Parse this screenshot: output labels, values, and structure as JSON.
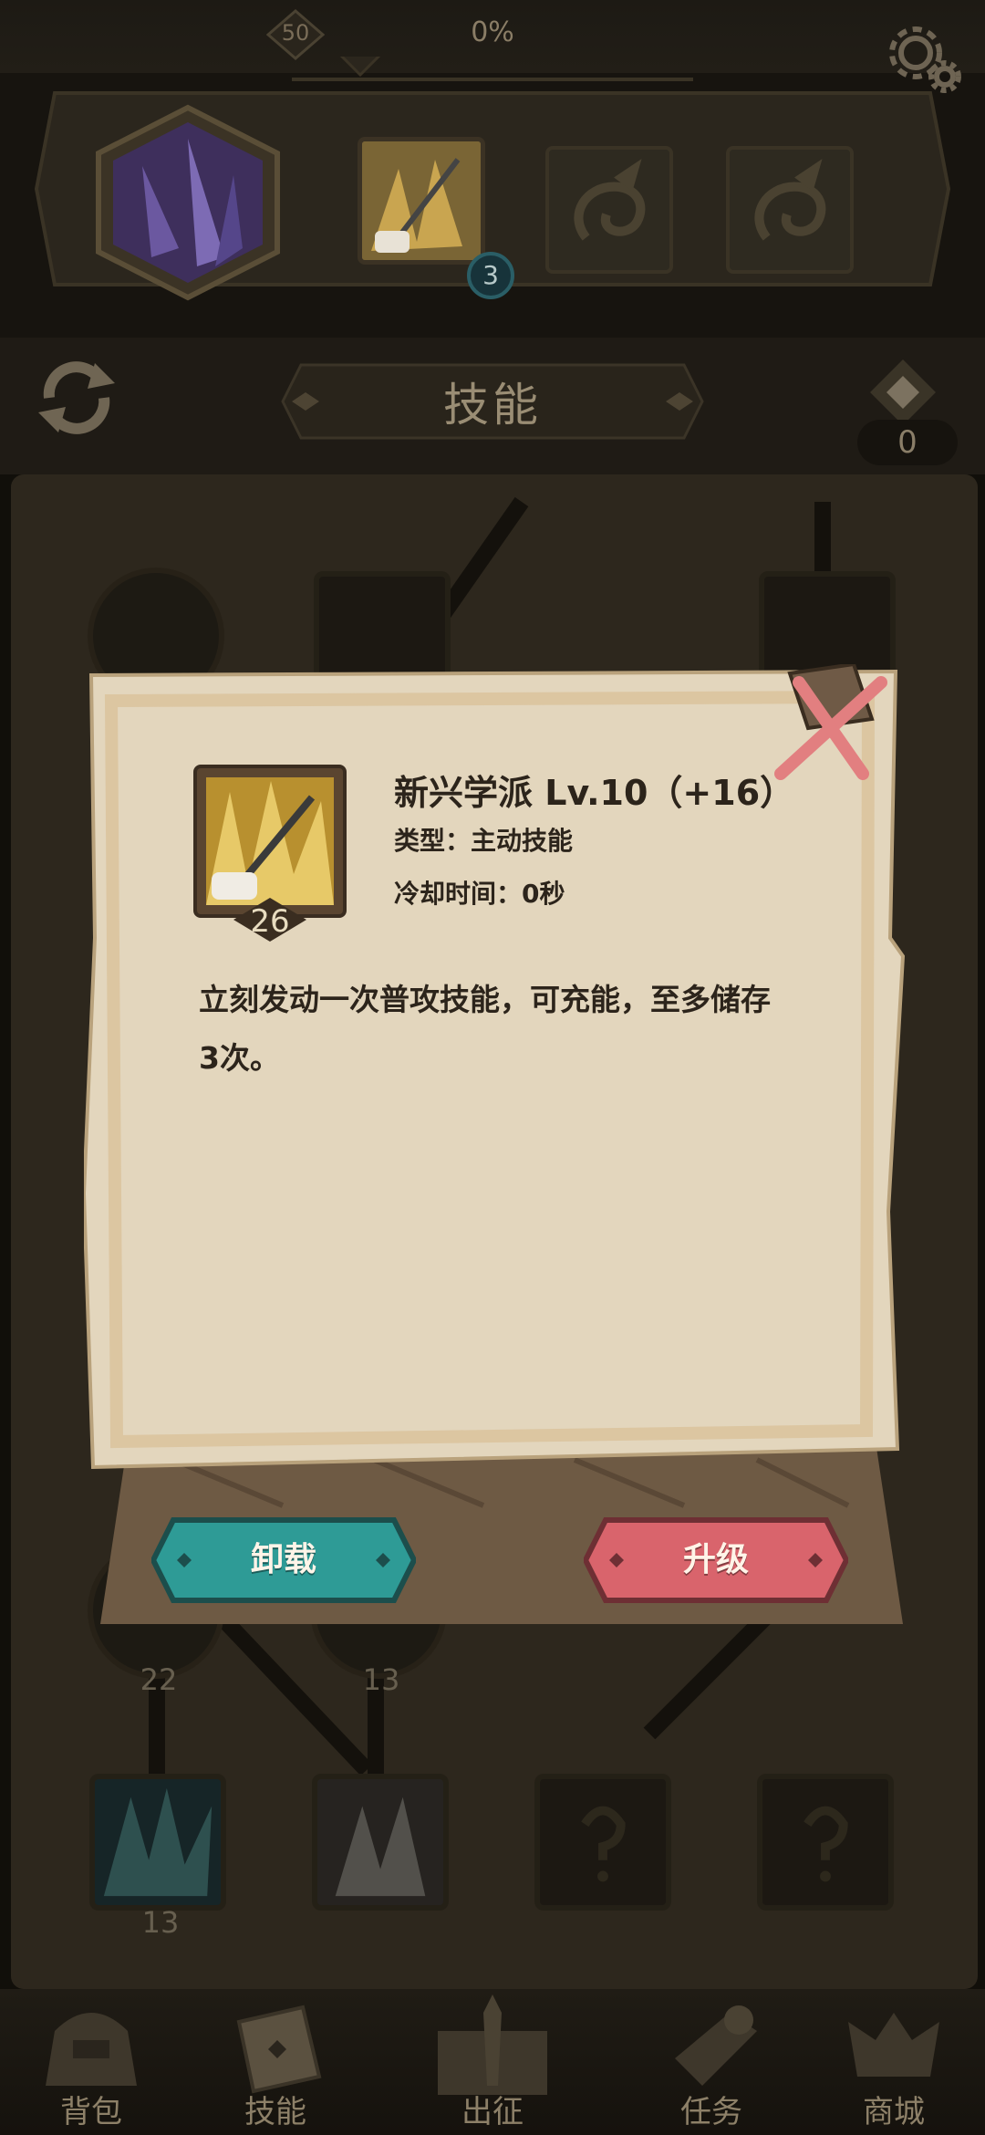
{
  "header": {
    "player_level": "50",
    "progress_percent": "0%",
    "settings_icon": "gear-icon"
  },
  "hero_slots": {
    "slot1_badge": "3"
  },
  "tabs": {
    "title": "技能",
    "points": "0"
  },
  "tree": {
    "node_numbers": [
      "22",
      "13",
      "13"
    ]
  },
  "popup": {
    "skill_name": "新兴学派  Lv.10（+16）",
    "skill_type": "类型：主动技能",
    "cooldown": "冷却时间：0秒",
    "skill_level": "26",
    "description": "立刻发动一次普攻技能，可充能，至多储存3次。",
    "unload_label": "卸载",
    "upgrade_label": "升级"
  },
  "colors": {
    "unload": "#2e9b96",
    "upgrade": "#d9646c",
    "parchment": "#e3d6bd"
  },
  "nav": [
    {
      "label": "背包"
    },
    {
      "label": "技能"
    },
    {
      "label": "出征"
    },
    {
      "label": "任务"
    },
    {
      "label": "商城"
    }
  ]
}
